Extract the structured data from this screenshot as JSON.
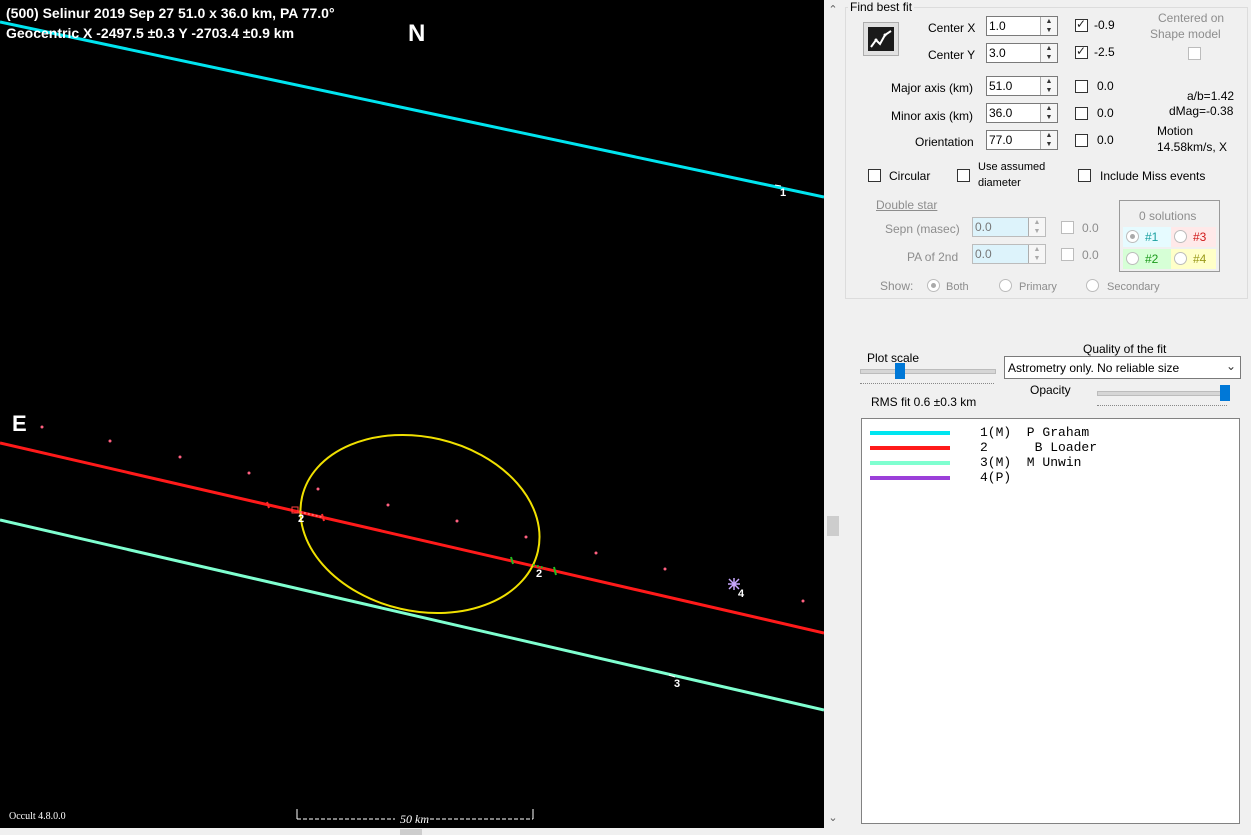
{
  "plot": {
    "title_line1": "(500) Selinur  2019 Sep 27   51.0 x 36.0 km, PA 77.0°",
    "title_line2": "Geocentric  X -2497.5 ±0.3  Y -2703.4 ±0.9 km",
    "north_label": "N",
    "east_label": "E",
    "version": "Occult 4.8.0.0",
    "scale_label": "50 km",
    "chord_labels": [
      "1",
      "2",
      "2",
      "3",
      "4"
    ],
    "colors": {
      "background": "#000000",
      "chord1": "#00e5f0",
      "chord2": "#ff1a1a",
      "chord3": "#7fffd0",
      "ellipse": "#f0e000",
      "dots": "#ff6080"
    }
  },
  "panel": {
    "find_best_fit": "Find best fit",
    "center_x_label": "Center X",
    "center_x_value": "1.0",
    "center_x_check_value": "-0.9",
    "center_y_label": "Center Y",
    "center_y_value": "3.0",
    "center_y_check_value": "-2.5",
    "centered_on_shape_line1": "Centered on",
    "centered_on_shape_line2": "Shape model",
    "major_label": "Major axis (km)",
    "major_value": "51.0",
    "major_check_value": "0.0",
    "minor_label": "Minor axis (km)",
    "minor_value": "36.0",
    "minor_check_value": "0.0",
    "orientation_label": "Orientation",
    "orientation_value": "77.0",
    "orientation_check_value": "0.0",
    "ab_ratio": "a/b=1.42",
    "dmag": "dMag=-0.38",
    "motion_label": "Motion",
    "motion_value": "14.58km/s, X",
    "circular_label": "Circular",
    "assumed_line1": "Use assumed",
    "assumed_line2": "diameter",
    "include_miss": "Include Miss events",
    "double_star": "Double star",
    "sepn_label": "Sepn (masec)",
    "sepn_value": "0.0",
    "sepn_check_value": "0.0",
    "pa2_label": "PA of 2nd",
    "pa2_value": "0.0",
    "pa2_check_value": "0.0",
    "solutions": "0 solutions",
    "sol1": "#1",
    "sol2": "#2",
    "sol3": "#3",
    "sol4": "#4",
    "show_label": "Show:",
    "show_both": "Both",
    "show_primary": "Primary",
    "show_secondary": "Secondary",
    "plot_scale": "Plot scale",
    "quality_label": "Quality of the fit",
    "quality_value": "Astrometry only. No reliable size",
    "opacity_label": "Opacity",
    "rms_fit": "RMS fit 0.6 ±0.3 km",
    "observers": [
      {
        "label": "1(M)  P Graham",
        "color": "#00e5f0"
      },
      {
        "label": "2      B Loader",
        "color": "#ff1a1a"
      },
      {
        "label": "3(M)  M Unwin",
        "color": "#7fffd0"
      },
      {
        "label": "4(P)",
        "color": "#9b3fd9"
      }
    ]
  }
}
